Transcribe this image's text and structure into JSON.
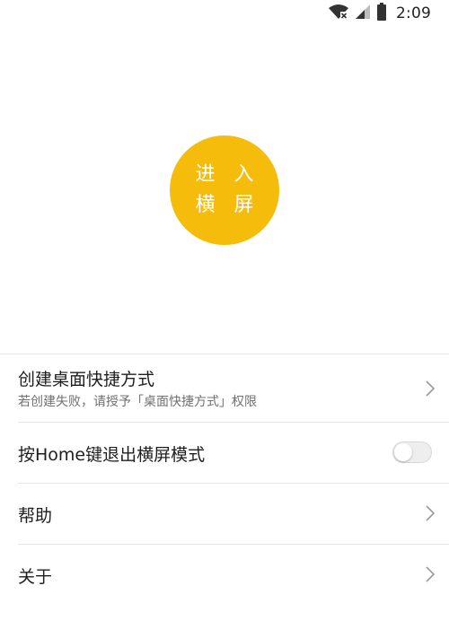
{
  "status_bar": {
    "time": "2:09",
    "icons": [
      "wifi-no-internet-icon",
      "cellular-signal-icon",
      "battery-icon"
    ]
  },
  "enter_button": {
    "line1": "进 入",
    "line2": "横 屏",
    "color": "#f5bc0c"
  },
  "menu": {
    "items": [
      {
        "title": "创建桌面快捷方式",
        "subtitle": "若创建失败，请授予「桌面快捷方式」权限",
        "control": "chevron-right-icon"
      },
      {
        "title": "按Home键退出横屏模式",
        "control": "toggle",
        "toggle_on": false
      },
      {
        "title": "帮助",
        "control": "chevron-right-icon"
      },
      {
        "title": "关于",
        "control": "chevron-right-icon"
      }
    ]
  }
}
